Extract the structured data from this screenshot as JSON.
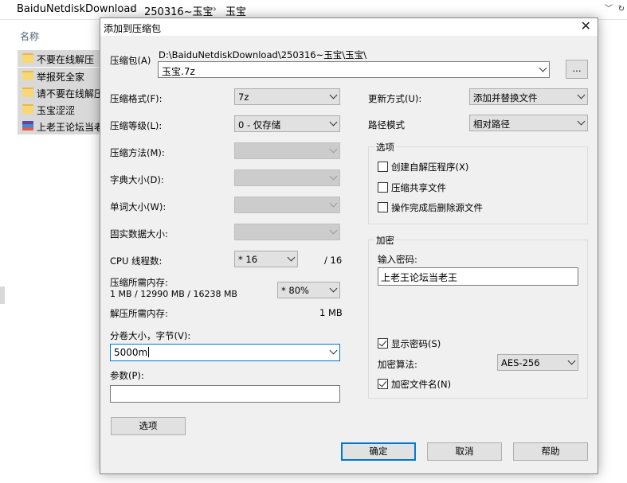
{
  "explorer": {
    "breadcrumb": [
      "BaiduNetdiskDownload",
      "250316~玉宝",
      "玉宝"
    ],
    "column_name": "名称",
    "files": [
      {
        "name": "不要在线解压",
        "type": "folder"
      },
      {
        "name": "举报死全家",
        "type": "folder"
      },
      {
        "name": "请不要在线解压",
        "type": "folder"
      },
      {
        "name": "玉宝涩涩",
        "type": "folder"
      },
      {
        "name": "上老王论坛当老",
        "type": "rar"
      }
    ]
  },
  "dialog": {
    "title": "添加到压缩包",
    "close_glyph": "✕",
    "archive": {
      "label": "压缩包(A)",
      "path": "D:\\BaiduNetdiskDownload\\250316~玉宝\\玉宝\\",
      "value": "玉宝.7z",
      "browse_label": "..."
    },
    "format": {
      "label": "压缩格式(F):",
      "value": "7z"
    },
    "level": {
      "label": "压缩等级(L):",
      "value": "0 - 仅存储"
    },
    "method": {
      "label": "压缩方法(M):",
      "value": ""
    },
    "dict": {
      "label": "字典大小(D):",
      "value": ""
    },
    "word": {
      "label": "单词大小(W):",
      "value": ""
    },
    "solid": {
      "label": "固实数据大小:",
      "value": ""
    },
    "threads": {
      "label": "CPU 线程数:",
      "value": "* 16",
      "total": "/ 16"
    },
    "mem_compress": {
      "label": "压缩所需内存:",
      "detail": "1 MB / 12990 MB / 16238 MB",
      "value": "* 80%"
    },
    "mem_decompress": {
      "label": "解压所需内存:",
      "value": "1 MB"
    },
    "volume": {
      "label": "分卷大小，字节(V):",
      "value": "5000m"
    },
    "params": {
      "label": "参数(P):",
      "value": ""
    },
    "options_btn": "选项",
    "update_mode": {
      "label": "更新方式(U):",
      "value": "添加并替换文件"
    },
    "path_mode": {
      "label": "路径模式",
      "value": "相对路径"
    },
    "options_group": {
      "title": "选项",
      "items": [
        {
          "label": "创建自解压程序(X)",
          "checked": false
        },
        {
          "label": "压缩共享文件",
          "checked": false
        },
        {
          "label": "操作完成后删除源文件",
          "checked": false
        }
      ]
    },
    "encryption": {
      "title": "加密",
      "password_label": "输入密码:",
      "password": "上老王论坛当老王",
      "show_password": {
        "label": "显示密码(S)",
        "checked": true
      },
      "method_label": "加密算法:",
      "method_value": "AES-256",
      "encrypt_names": {
        "label": "加密文件名(N)",
        "checked": true
      }
    },
    "buttons": {
      "ok": "确定",
      "cancel": "取消",
      "help": "帮助"
    }
  }
}
